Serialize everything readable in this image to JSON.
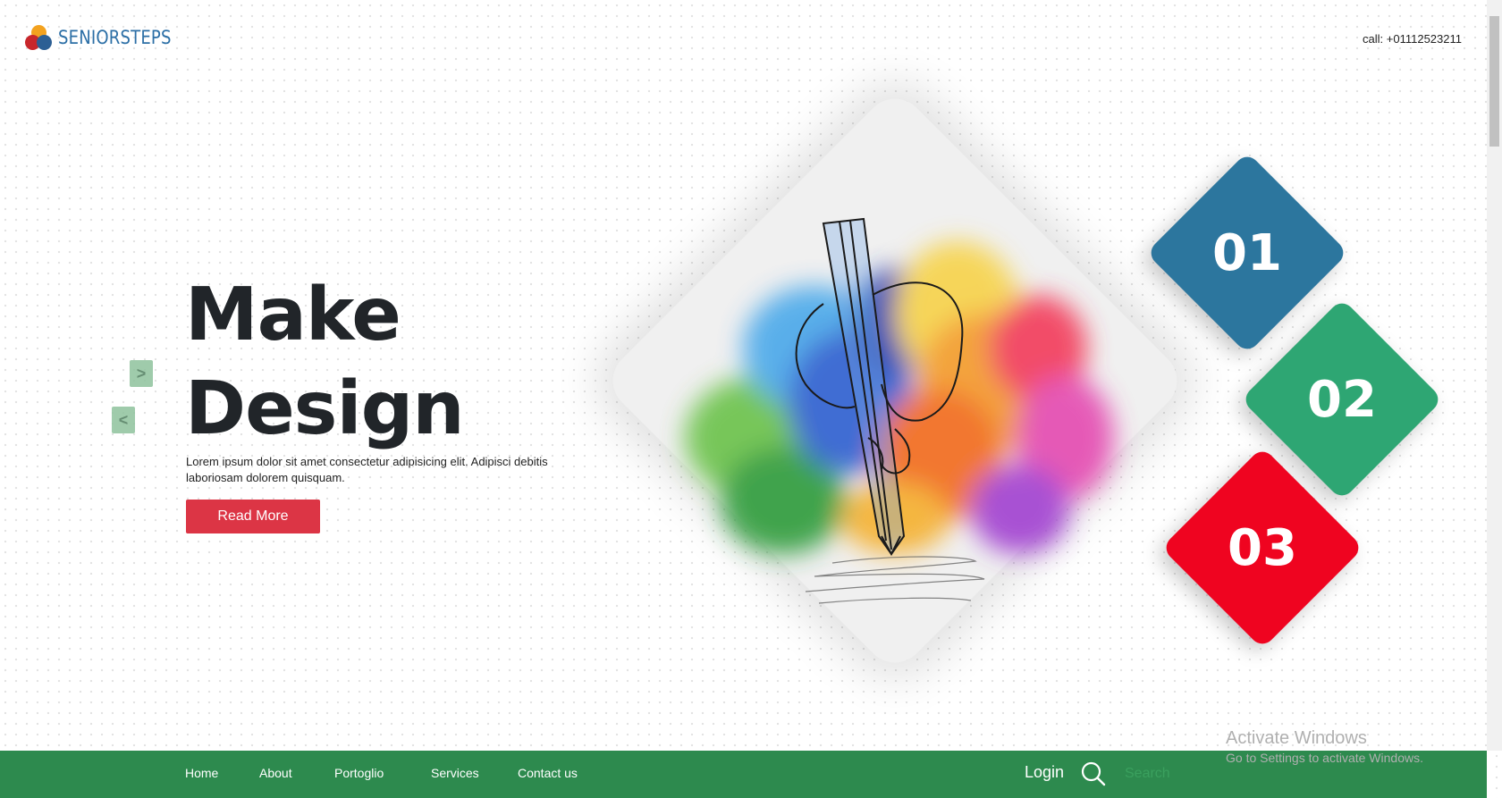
{
  "header": {
    "brand": "SENIORSTEPS",
    "call": "call: +01112523211"
  },
  "hero": {
    "title_line1": "Make",
    "title_line2": "Design",
    "description": "Lorem ipsum dolor sit amet consectetur adipisicing elit. Adipisci debitis laboriosam dolorem quisquam.",
    "button_label": "Read More",
    "next_arrow": ">",
    "prev_arrow": "<"
  },
  "features": [
    {
      "number": "01",
      "color": "#2c769e"
    },
    {
      "number": "02",
      "color": "#2ea673"
    },
    {
      "number": "03",
      "color": "#ef0420"
    }
  ],
  "nav": {
    "items": [
      "Home",
      "About",
      "Portoglio",
      "Services",
      "Contact us"
    ],
    "login": "Login",
    "search_placeholder": "Search"
  },
  "watermark": {
    "line1": "Activate Windows",
    "line2": "Go to Settings to activate Windows."
  },
  "colors": {
    "brand_blue": "#2c6fa6",
    "nav_green": "#2d8a4e",
    "button_red": "#dc3545"
  },
  "icons": [
    "logo-icon",
    "chevron-right-icon",
    "chevron-left-icon",
    "search-icon"
  ]
}
